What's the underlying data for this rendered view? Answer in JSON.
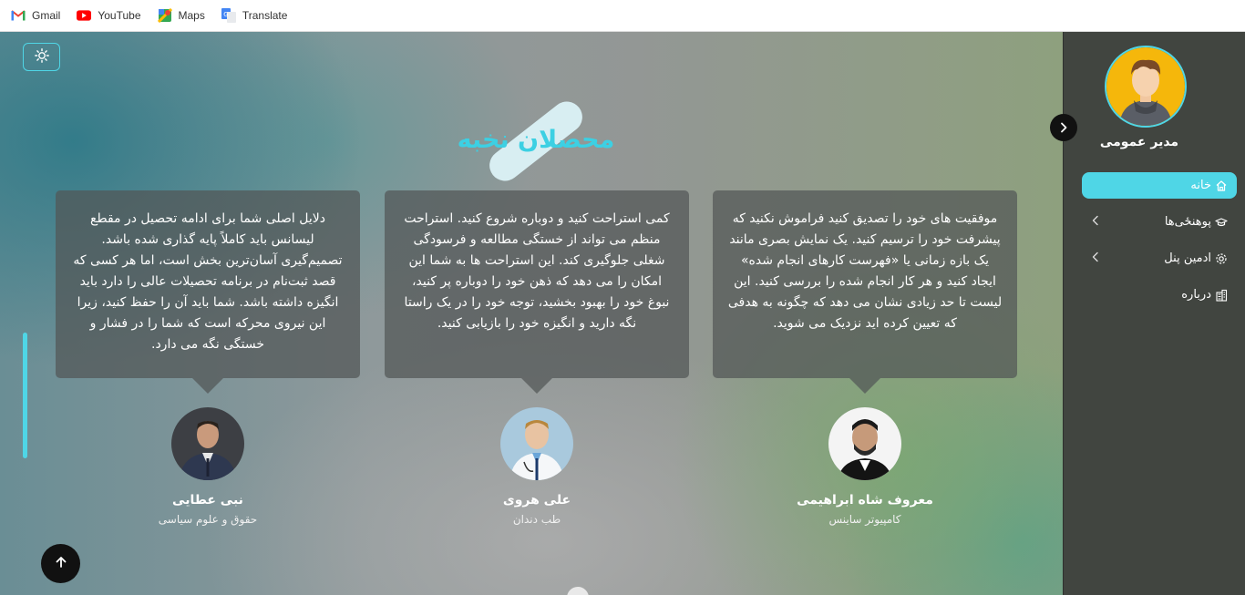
{
  "bookmarks": [
    {
      "label": "Gmail",
      "icon": "gmail-icon"
    },
    {
      "label": "YouTube",
      "icon": "youtube-icon"
    },
    {
      "label": "Maps",
      "icon": "maps-icon"
    },
    {
      "label": "Translate",
      "icon": "translate-icon"
    }
  ],
  "section": {
    "title": "محصلان نخبه"
  },
  "testimonials": [
    {
      "text": "موفقیت های خود را تصدیق کنید فراموش نکنید که پیشرفت خود را ترسیم کنید. یک نمایش بصری مانند یک بازه زمانی یا «فهرست کارهای انجام شده» ایجاد کنید و هر کار انجام شده را بررسی کنید. این لیست تا حد زیادی نشان می دهد که چگونه به هدفی که تعیین کرده اید نزدیک می شوید.",
      "name": "معروف شاه ابراهیمی",
      "field": "کامپیوتر ساینس"
    },
    {
      "text": "کمی استراحت کنید و دوباره شروع کنید. استراحت منظم می تواند از خستگی مطالعه و فرسودگی شغلی جلوگیری کند. این استراحت ها به شما این امکان را می دهد که ذهن خود را دوباره پر کنید، نبوغ خود را بهبود بخشید، توجه خود را در یک راستا نگه دارید و انگیزه خود را بازیابی کنید.",
      "name": "علی هروی",
      "field": "طب دندان"
    },
    {
      "text": "دلایل اصلی شما برای ادامه تحصیل در مقطع لیسانس باید کاملاً پایه گذاری شده باشد. تصمیم‌گیری آسان‌ترین بخش است، اما هر کسی که قصد ثبت‌نام در برنامه تحصیلات عالی را دارد باید انگیزه داشته باشد. شما باید آن را حفظ کنید، زیرا این نیروی محرکه است که شما را در فشار و خستگی نگه می دارد.",
      "name": "نبی عطایی",
      "field": "حقوق و علوم سیاسی"
    }
  ],
  "sidebar": {
    "profile_name": "مدیر عمومی",
    "items": [
      {
        "label": "خانه",
        "icon": "home-icon",
        "active": true
      },
      {
        "label": "پوهنځی‌ها",
        "icon": "graduation-cap-icon",
        "has_submenu": true
      },
      {
        "label": "ادمین پنل",
        "icon": "gear-icon",
        "has_submenu": true
      },
      {
        "label": "درباره",
        "icon": "building-icon"
      }
    ]
  },
  "colors": {
    "accent": "#4fd6e6",
    "sidebar": "#414540"
  }
}
